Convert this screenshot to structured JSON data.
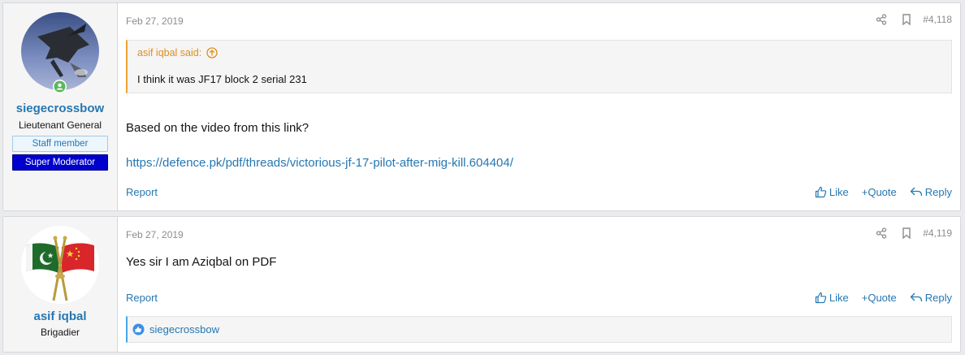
{
  "posts": [
    {
      "user": {
        "name": "siegecrossbow",
        "title": "Lieutenant General",
        "banners": [
          "Staff member",
          "Super Moderator"
        ],
        "online": true
      },
      "date": "Feb 27, 2019",
      "number": "#4,118",
      "quote": {
        "author": "asif iqbal said:",
        "text": "I think it was JF17 block 2 serial 231"
      },
      "text": "Based on the video from this link?",
      "link": "https://defence.pk/pdf/threads/victorious-jf-17-pilot-after-mig-kill.604404/",
      "report_label": "Report",
      "actions": {
        "like": "Like",
        "quote": "+Quote",
        "reply": "Reply"
      }
    },
    {
      "user": {
        "name": "asif iqbal",
        "title": "Brigadier"
      },
      "date": "Feb 27, 2019",
      "number": "#4,119",
      "text": "Yes sir I am Aziqbal on PDF",
      "report_label": "Report",
      "actions": {
        "like": "Like",
        "quote": "+Quote",
        "reply": "Reply"
      },
      "reactions": {
        "users": "siegecrossbow"
      }
    }
  ],
  "colors": {
    "link": "#2577b1",
    "quote_accent": "#f0a233",
    "moderator_banner": "#0000cd",
    "online": "#5cb85c"
  }
}
